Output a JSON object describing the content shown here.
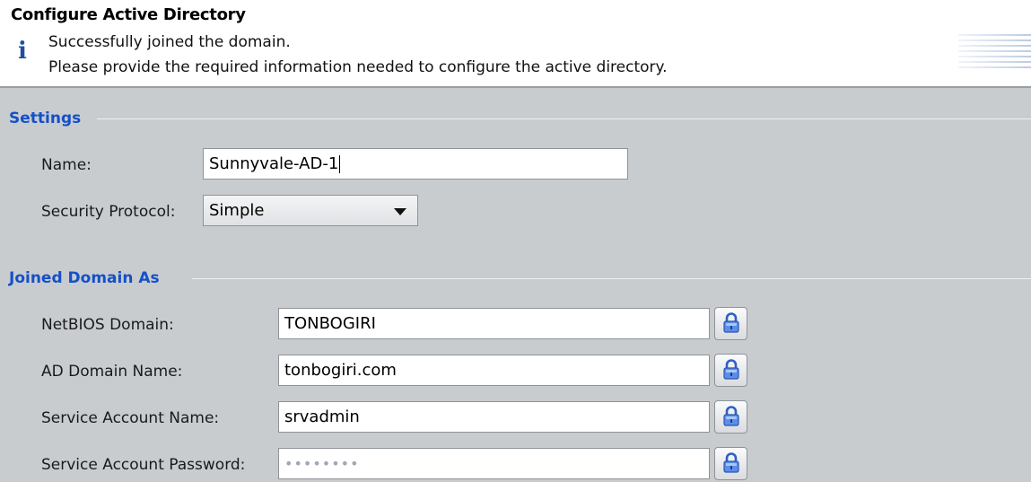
{
  "header": {
    "title": "Configure Active Directory",
    "info_icon": "i",
    "message_line1": "Successfully joined the domain.",
    "message_line2": "Please provide the required information needed to configure the active directory."
  },
  "settings": {
    "group_title": "Settings",
    "name_label": "Name:",
    "name_value": "Sunnyvale-AD-1",
    "security_protocol_label": "Security Protocol:",
    "security_protocol_value": "Simple"
  },
  "joined_domain": {
    "group_title": "Joined Domain As",
    "netbios_label": "NetBIOS Domain:",
    "netbios_value": "TONBOGIRI",
    "ad_domain_label": "AD Domain Name:",
    "ad_domain_value": "tonbogiri.com",
    "service_account_label": "Service Account Name:",
    "service_account_value": "srvadmin",
    "service_password_label": "Service Account Password:",
    "service_password_value": "••••••••"
  },
  "icons": {
    "info": "info-icon",
    "lock": "lock-icon",
    "dropdown": "chevron-down-icon"
  },
  "colors": {
    "group_title": "#1550c8",
    "panel_background": "#c9cccf",
    "lock_icon": "#3b6fd6"
  }
}
